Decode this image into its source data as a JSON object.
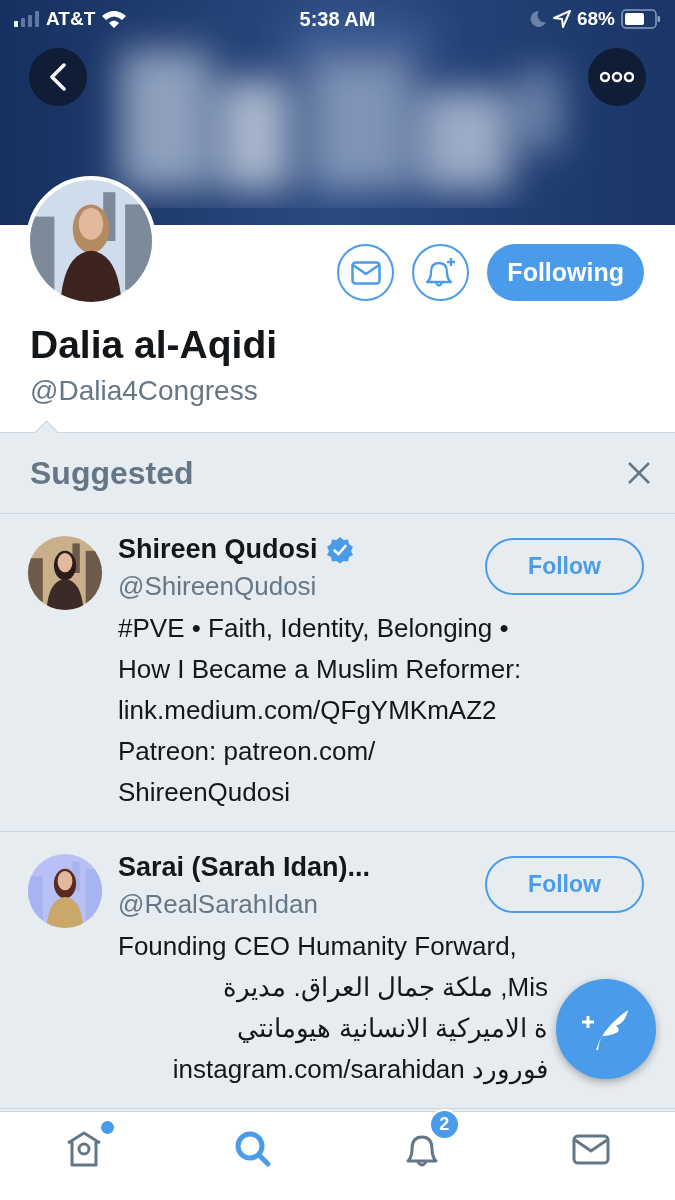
{
  "status_bar": {
    "carrier": "AT&T",
    "time": "5:38 AM",
    "battery": "68%"
  },
  "profile": {
    "name": "Dalia al-Aqidi",
    "handle": "@Dalia4Congress",
    "follow_button": "Following"
  },
  "suggested": {
    "title": "Suggested",
    "accounts": [
      {
        "name": "Shireen Qudosi",
        "verified": true,
        "handle": "@ShireenQudosi",
        "button": "Follow",
        "bio": [
          {
            "text": "#PVE • Faith, Identity, Belonging •",
            "rtl": false
          },
          {
            "text": "How I Became a Muslim Reformer:",
            "rtl": false
          },
          {
            "text": "link.medium.com/QFgYMKmAZ2",
            "rtl": false
          },
          {
            "text": "Patreon: patreon.com/",
            "rtl": false
          },
          {
            "text": "ShireenQudosi",
            "rtl": false
          }
        ]
      },
      {
        "name": "Sarai (Sarah Idan)...",
        "verified": false,
        "handle": "@RealSarahIdan",
        "button": "Follow",
        "bio": [
          {
            "text": "Founding CEO Humanity Forward,",
            "rtl": false
          },
          {
            "text": "Mis, ملكة جمال العراق. مديرة",
            "rtl": true
          },
          {
            "text": "ة الاميركية الانسانية هيومانتي",
            "rtl": true
          },
          {
            "text": "فورورد instagram.com/sarahidan",
            "rtl": true
          }
        ]
      }
    ]
  },
  "tab_bar": {
    "tabs": [
      {
        "kind": "home",
        "selected": false,
        "dot": true
      },
      {
        "kind": "search",
        "selected": true,
        "dot": false
      },
      {
        "kind": "notifications",
        "selected": false,
        "dot": false,
        "badge": "2"
      },
      {
        "kind": "messages",
        "selected": false,
        "dot": false
      }
    ]
  }
}
